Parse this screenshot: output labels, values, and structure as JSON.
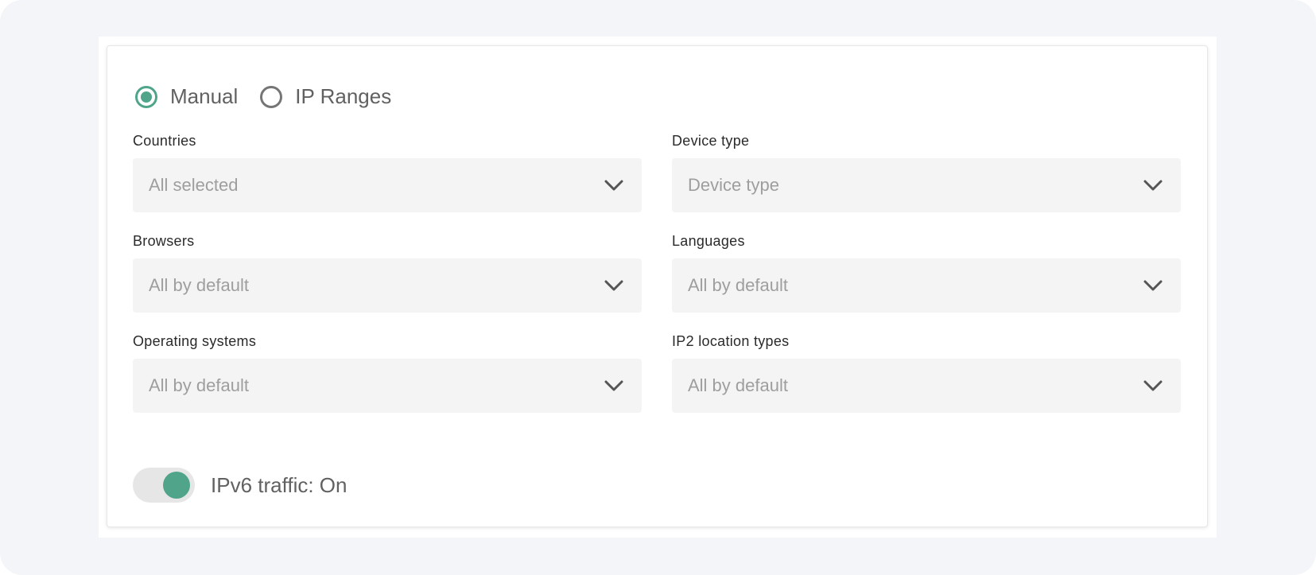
{
  "mode": {
    "options": [
      {
        "label": "Manual",
        "checked": true
      },
      {
        "label": "IP Ranges",
        "checked": false
      }
    ]
  },
  "fields": {
    "countries": {
      "label": "Countries",
      "value": "All selected"
    },
    "device_type": {
      "label": "Device type",
      "value": "Device type"
    },
    "browsers": {
      "label": "Browsers",
      "value": "All by default"
    },
    "languages": {
      "label": "Languages",
      "value": "All by default"
    },
    "operating_systems": {
      "label": "Operating systems",
      "value": "All by default"
    },
    "ip2_location_types": {
      "label": "IP2 location types",
      "value": "All by default"
    }
  },
  "ipv6": {
    "label": "IPv6 traffic: On",
    "enabled": true
  },
  "icons": {
    "dropdown": "chevron-down-icon"
  },
  "colors": {
    "accent": "#4fa48a",
    "field_bg": "#f4f4f4",
    "page_bg": "#f4f5f9",
    "placeholder_text": "#9e9e9e",
    "label_text": "#2a2a2a"
  }
}
